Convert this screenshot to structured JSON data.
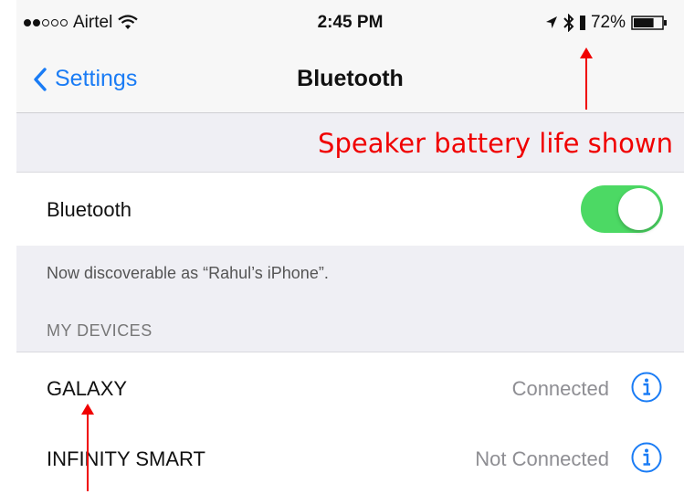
{
  "status_bar": {
    "carrier": "Airtel",
    "signal": {
      "filled": 2,
      "total": 5
    },
    "time": "2:45 PM",
    "battery_percent": "72%",
    "battery_level": 0.72,
    "icons": [
      "wifi-icon",
      "location-arrow-icon",
      "bluetooth-icon",
      "speaker-battery-icon",
      "battery-icon"
    ]
  },
  "nav": {
    "back_label": "Settings",
    "title": "Bluetooth"
  },
  "annotation": {
    "text": "Speaker battery life shown",
    "color": "#f00000"
  },
  "bluetooth_row": {
    "label": "Bluetooth",
    "toggle_on": true,
    "toggle_color": "#4cd964"
  },
  "discoverable_text": "Now discoverable as “Rahul’s iPhone”.",
  "section_header": "MY DEVICES",
  "devices": [
    {
      "name": "GALAXY",
      "status": "Connected"
    },
    {
      "name": "INFINITY SMART",
      "status": "Not Connected"
    }
  ],
  "colors": {
    "accent": "#1a7cf5",
    "annotation": "#f00000",
    "toggle_on": "#4cd964"
  }
}
